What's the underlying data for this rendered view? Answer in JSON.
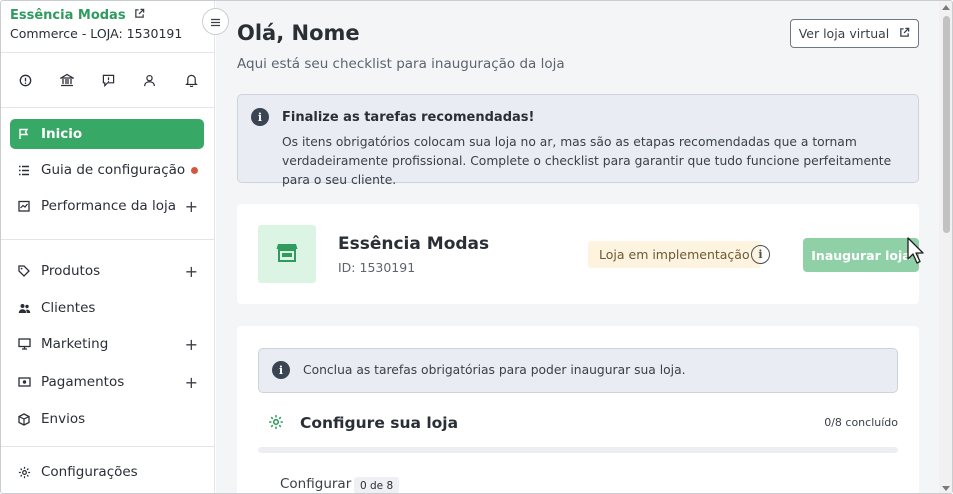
{
  "sidebar": {
    "store_name": "Essência Modas",
    "store_sub": "Commerce - LOJA: 1530191",
    "top_icons": [
      "info-icon",
      "bank-icon",
      "chat-icon",
      "user-icon",
      "bell-icon"
    ],
    "items": [
      {
        "label": "Inicio",
        "icon": "flag-icon"
      },
      {
        "label": "Guia de configuração",
        "icon": "list-icon"
      },
      {
        "label": "Performance da loja",
        "icon": "chart-icon"
      },
      {
        "label": "Produtos",
        "icon": "tag-icon"
      },
      {
        "label": "Clientes",
        "icon": "users-icon"
      },
      {
        "label": "Marketing",
        "icon": "monitor-icon"
      },
      {
        "label": "Pagamentos",
        "icon": "money-icon"
      },
      {
        "label": "Envios",
        "icon": "box-icon"
      },
      {
        "label": "Configurações",
        "icon": "gear-icon"
      }
    ],
    "notification_color": "#d2593f"
  },
  "header": {
    "greeting": "Olá, Nome",
    "subtitle": "Aqui está seu checklist para inauguração da loja",
    "view_store_label": "Ver loja virtual"
  },
  "alert": {
    "title": "Finalize as tarefas recomendadas!",
    "text": "Os itens obrigatórios colocam sua loja no ar, mas são as etapas recomendadas que a tornam verdadeiramente profissional. Complete o checklist para garantir que tudo funcione perfeitamente para o seu cliente."
  },
  "store_card": {
    "name": "Essência Modas",
    "id": "ID: 1530191",
    "status": "Loja em implementação",
    "inaugurate_label": "Inaugurar loja"
  },
  "checklist": {
    "notice": "Conclua as tarefas obrigatórias para poder inaugurar sua loja.",
    "title": "Configure sua loja",
    "count": "0/8 concluído",
    "progress": 0,
    "section_label": "Configurar",
    "section_badge": "0 de 8"
  },
  "colors": {
    "accent": "#37a866",
    "brand_text": "#2f9b5e",
    "button_disabled": "#8fd0a7"
  }
}
